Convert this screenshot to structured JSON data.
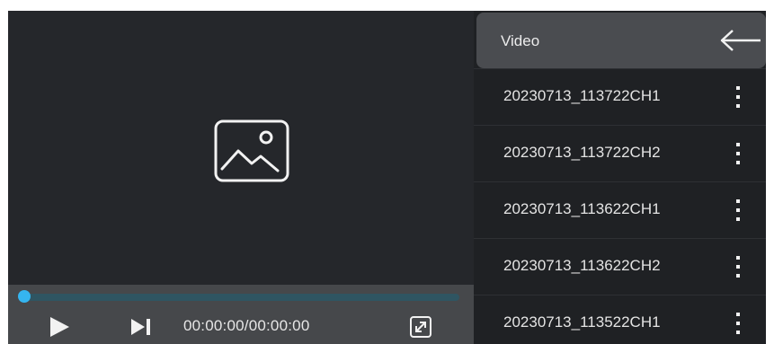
{
  "player": {
    "placeholder_icon": "image-placeholder-icon",
    "progress": 0.0,
    "time_display": "00:00:00/00:00:00",
    "icons": {
      "play": "play-icon",
      "next": "skip-next-icon",
      "fullscreen": "fullscreen-icon"
    },
    "colors": {
      "progress_knob": "#35b5f0",
      "progress_track": "#2f5562"
    }
  },
  "sidebar": {
    "title": "Video",
    "back_icon": "arrow-left-icon",
    "items": [
      {
        "name": "20230713_113722CH1",
        "menu_icon": "more-vertical-icon"
      },
      {
        "name": "20230713_113722CH2",
        "menu_icon": "more-vertical-icon"
      },
      {
        "name": "20230713_113622CH1",
        "menu_icon": "more-vertical-icon"
      },
      {
        "name": "20230713_113622CH2",
        "menu_icon": "more-vertical-icon"
      },
      {
        "name": "20230713_113522CH1",
        "menu_icon": "more-vertical-icon"
      }
    ]
  }
}
